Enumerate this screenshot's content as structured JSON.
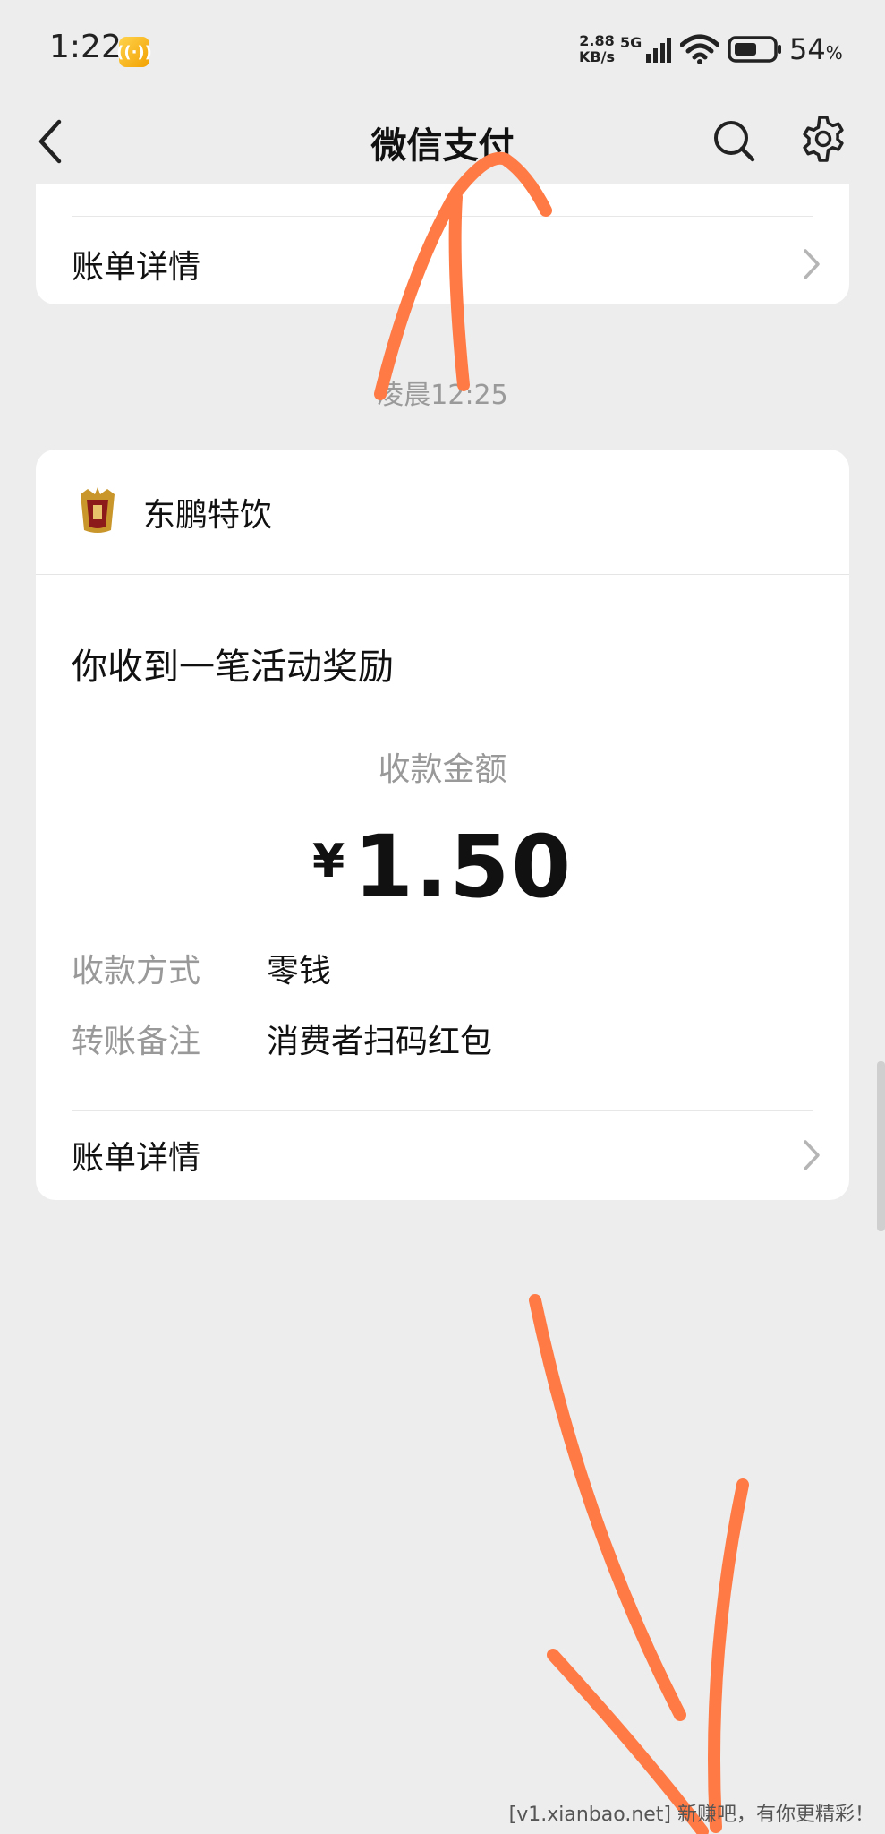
{
  "status_bar": {
    "time": "1:22",
    "net_speed_value": "2.88",
    "net_speed_unit": "KB/s",
    "network_type": "5G",
    "battery_percent": "54",
    "battery_unit": "%"
  },
  "nav": {
    "title": "微信支付"
  },
  "top_card": {
    "bill_details_label": "账单详情"
  },
  "timestamp": "凌晨12:25",
  "message_card": {
    "merchant_name": "东鹏特饮",
    "title": "你收到一笔活动奖励",
    "amount_label": "收款金额",
    "currency_symbol": "¥",
    "amount": "1.50",
    "details": [
      {
        "key": "收款方式",
        "value": "零钱"
      },
      {
        "key": "转账备注",
        "value": "消费者扫码红包"
      }
    ],
    "bill_details_label": "账单详情"
  },
  "watermark": "[v1.xianbao.net] 新赚吧，有你更精彩！",
  "colors": {
    "background": "#ededed",
    "card": "#ffffff",
    "annotation": "#ff7a45",
    "secondary_text": "#999999"
  }
}
